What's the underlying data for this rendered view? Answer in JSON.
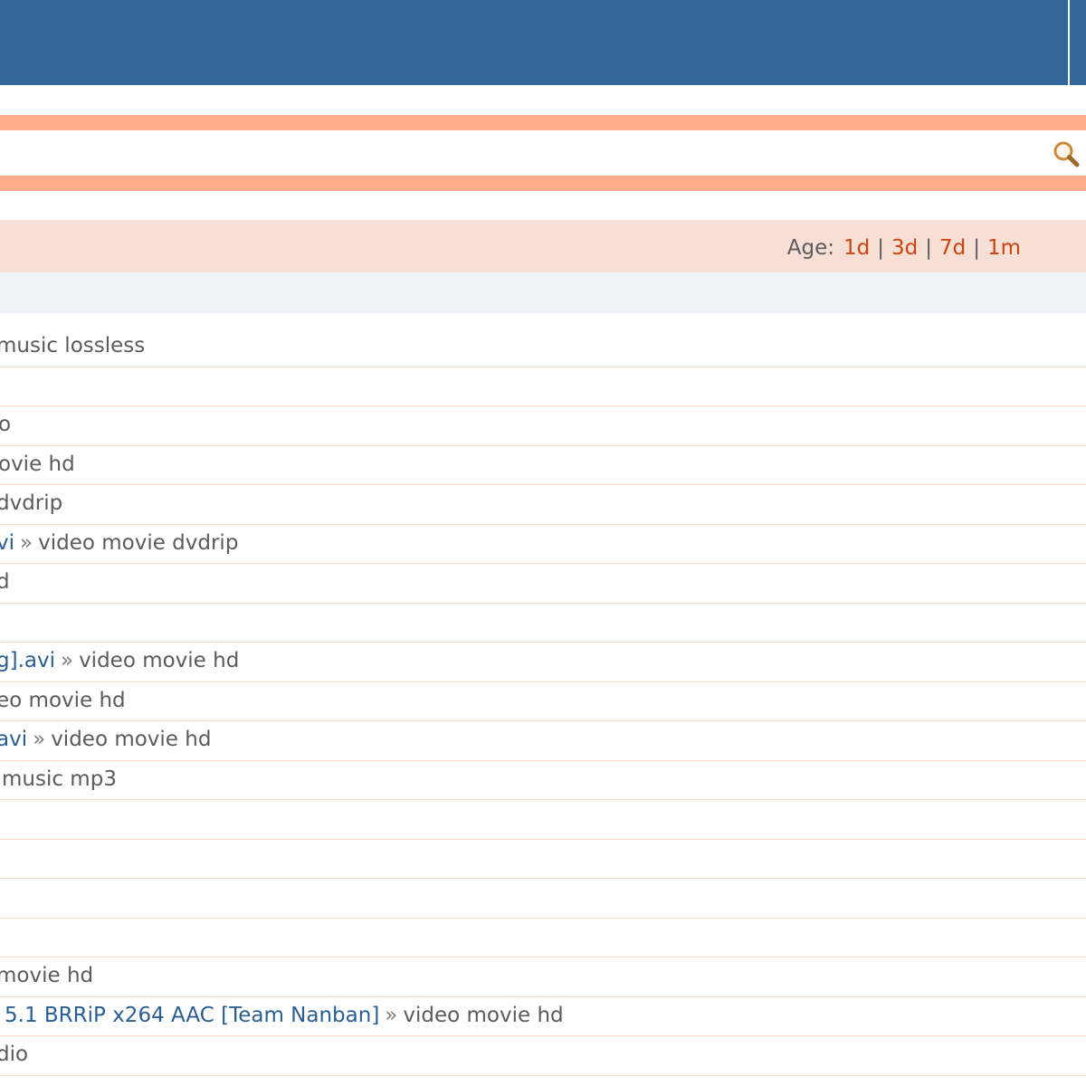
{
  "search": {
    "value": "",
    "placeholder": ""
  },
  "filters": {
    "age_label": "Age:",
    "options": [
      "1d",
      "3d",
      "7d",
      "1m"
    ]
  },
  "results": [
    {
      "title": "",
      "category": "music lossless",
      "lead": "",
      "offset": -4
    },
    {
      "title": "",
      "category": "",
      "lead": "",
      "offset": 0
    },
    {
      "title": "",
      "category": "o",
      "lead": "",
      "offset": -2
    },
    {
      "title": "",
      "category": "ovie hd",
      "lead": "",
      "offset": -2
    },
    {
      "title": "",
      "category": "dvdrip",
      "lead": "",
      "offset": -4
    },
    {
      "title": "vi",
      "category": "video movie dvdrip",
      "lead": "",
      "offset": -4
    },
    {
      "title": "",
      "category": "d",
      "lead": "",
      "offset": -4
    },
    {
      "title": "",
      "category": "",
      "lead": "",
      "offset": 0
    },
    {
      "title": "g].avi",
      "category": "video movie hd",
      "lead": "",
      "offset": -4
    },
    {
      "title": "",
      "category": "eo movie hd",
      "lead": "",
      "offset": -4
    },
    {
      "title": "avi",
      "category": "video movie hd",
      "lead": "",
      "offset": -4
    },
    {
      "title": "",
      "category": "music mp3",
      "lead": "",
      "offset": 2
    },
    {
      "title": "",
      "category": "",
      "lead": "",
      "offset": 0
    },
    {
      "title": "",
      "category": "",
      "lead": "",
      "offset": 0
    },
    {
      "title": "",
      "category": "",
      "lead": "",
      "offset": 0
    },
    {
      "title": "",
      "category": "",
      "lead": "",
      "offset": 0
    },
    {
      "title": "",
      "category": "movie hd",
      "lead": "",
      "offset": -4
    },
    {
      "title": "5.1 BRRiP x264 AAC [Team Nanban]",
      "category": "video movie hd",
      "lead": "",
      "offset": 5
    },
    {
      "title": "",
      "category": "dio",
      "lead": "",
      "offset": -4
    }
  ],
  "colors": {
    "header": "#336699",
    "search_bar": "#ffad8a",
    "filter_bar": "#f7dfd6",
    "subheader": "#eef2f9",
    "link": "#2a5e93",
    "age_link": "#cc4410",
    "text": "#5b5b5b"
  }
}
